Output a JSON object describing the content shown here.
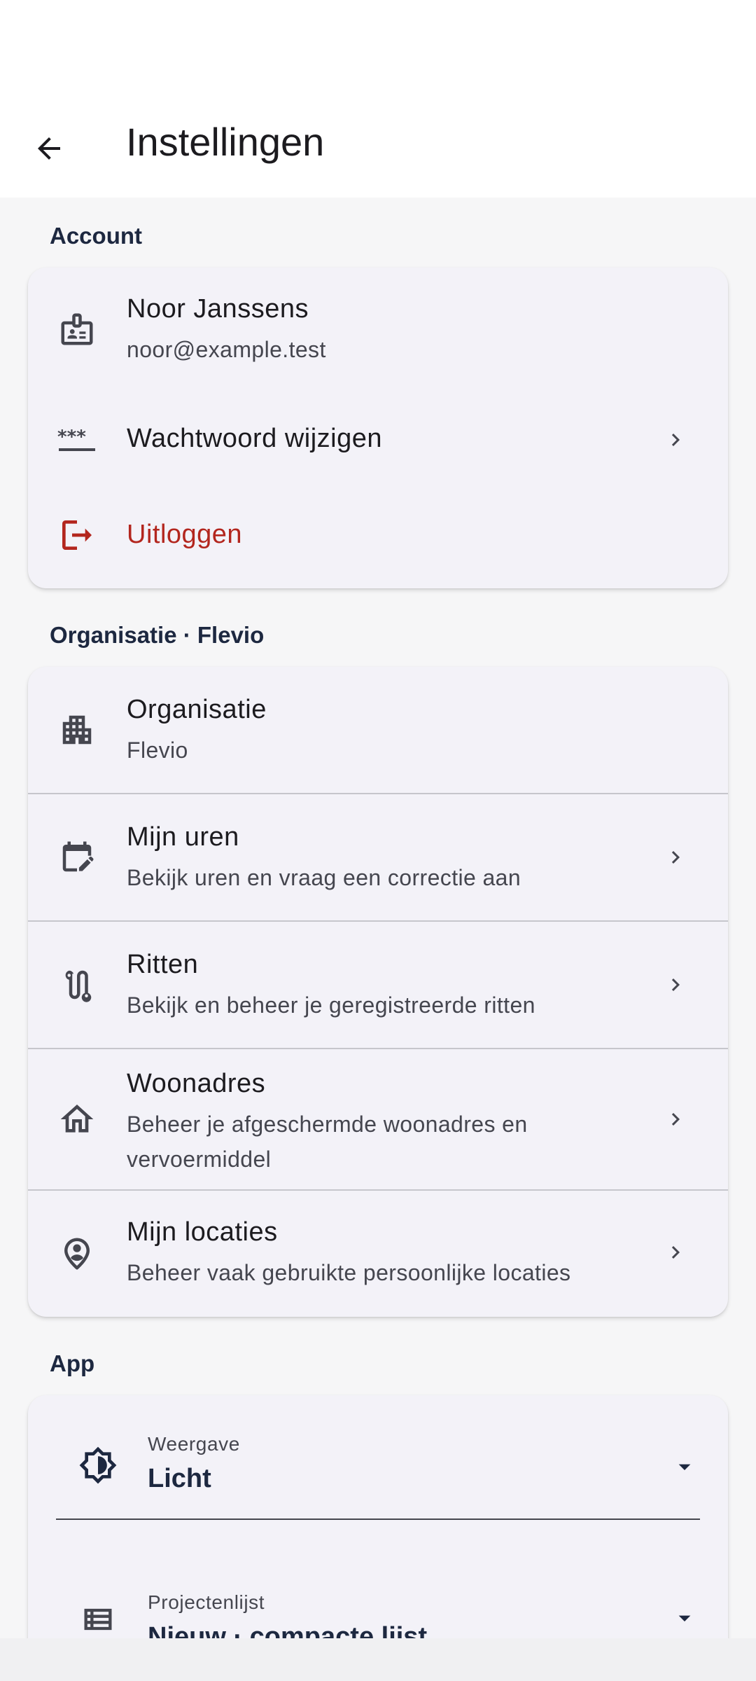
{
  "header": {
    "title": "Instellingen"
  },
  "account": {
    "section_title": "Account",
    "user_name": "Noor Janssens",
    "user_email": "noor@example.test",
    "change_password": "Wachtwoord wijzigen",
    "logout": "Uitloggen"
  },
  "organisation": {
    "section_title": "Organisatie · Flevio",
    "items": [
      {
        "title": "Organisatie",
        "subtitle": "Flevio"
      },
      {
        "title": "Mijn uren",
        "subtitle": "Bekijk uren en vraag een correctie aan"
      },
      {
        "title": "Ritten",
        "subtitle": "Bekijk en beheer je geregistreerde ritten"
      },
      {
        "title": "Woonadres",
        "subtitle": "Beheer je afgeschermde woonadres en vervoermiddel"
      },
      {
        "title": "Mijn locaties",
        "subtitle": "Beheer vaak gebruikte persoonlijke locaties"
      }
    ]
  },
  "app": {
    "section_title": "App",
    "appearance_label": "Weergave",
    "appearance_value": "Licht",
    "projects_label": "Projectenlijst",
    "projects_value": "Nieuw · compacte lijst"
  },
  "colors": {
    "danger": "#b3261e",
    "navy": "#1d2840",
    "card": "#f3f2f8",
    "background": "#f6f6f7"
  }
}
